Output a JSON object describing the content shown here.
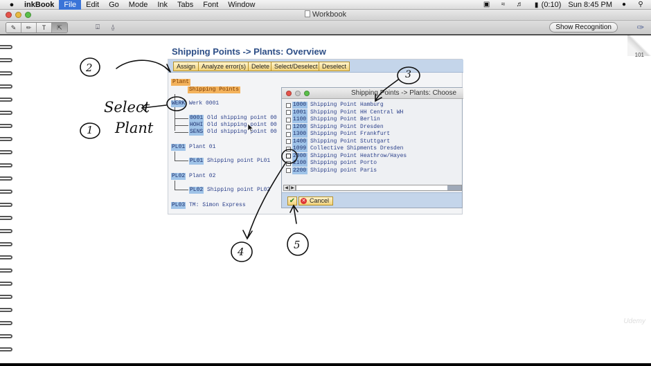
{
  "menubar": {
    "app_name": "inkBook",
    "items": [
      "File",
      "Edit",
      "Go",
      "Mode",
      "Ink",
      "Tabs",
      "Font",
      "Window"
    ],
    "battery": "(0:10)",
    "clock": "Sun 8:45 PM"
  },
  "window": {
    "title": "Workbook"
  },
  "toolbar": {
    "tools": [
      "pen-tool",
      "highlighter-tool",
      "text-tool",
      "select-tool"
    ],
    "show_recognition_label": "Show Recognition"
  },
  "page": {
    "page_number": "101",
    "watermark": "Udemy"
  },
  "sap": {
    "title": "Shipping Points -> Plants: Overview",
    "buttons": [
      "Assign",
      "Analyze error(s)",
      "Delete",
      "Select/Deselect",
      "Deselect"
    ],
    "tree": {
      "root": "Plant",
      "node": "Shipping Points",
      "plants": [
        {
          "code": "WERK",
          "name": "Werk 0001",
          "children": [
            {
              "code": "0001",
              "name": "Old shipping point 00"
            },
            {
              "code": "HOHI",
              "name": "Old shipping point 00"
            },
            {
              "code": "SENS",
              "name": "Old shipping point 00"
            }
          ]
        },
        {
          "code": "PL01",
          "name": "Plant 01",
          "children": [
            {
              "code": "PL01",
              "name": "Shipping point PL01"
            }
          ]
        },
        {
          "code": "PL02",
          "name": "Plant 02",
          "children": [
            {
              "code": "PL02",
              "name": "Shipping point PL02"
            }
          ]
        },
        {
          "code": "PL03",
          "name": "TM: Simon Express",
          "children": []
        }
      ]
    },
    "popup": {
      "title": "Shipping Points -> Plants: Choose",
      "rows": [
        {
          "code": "1000",
          "name": "Shipping Point Hamburg",
          "checked": false
        },
        {
          "code": "1001",
          "name": "Shipping Point HH Central WH",
          "checked": false
        },
        {
          "code": "1100",
          "name": "Shipping Point Berlin",
          "checked": false
        },
        {
          "code": "1200",
          "name": "Shipping Point Dresden",
          "checked": false
        },
        {
          "code": "1300",
          "name": "Shipping Point Frankfurt",
          "checked": false
        },
        {
          "code": "1400",
          "name": "Shipping Point Stuttgart",
          "checked": false
        },
        {
          "code": "1099",
          "name": "Collective Shipments Dresden",
          "checked": false
        },
        {
          "code": "2000",
          "name": "Shipping Point Heathrow/Hayes",
          "checked": true
        },
        {
          "code": "2100",
          "name": "Shipping point Porto",
          "checked": false
        },
        {
          "code": "2200",
          "name": "Shipping point Paris",
          "checked": false
        }
      ],
      "confirm_icon": "checkmark-icon",
      "cancel_label": "Cancel"
    }
  },
  "annotations": {
    "step1": "1",
    "step2": "2",
    "step3": "3",
    "step4": "4",
    "step5": "5",
    "select_label": "Select",
    "plant_label": "Plant"
  }
}
